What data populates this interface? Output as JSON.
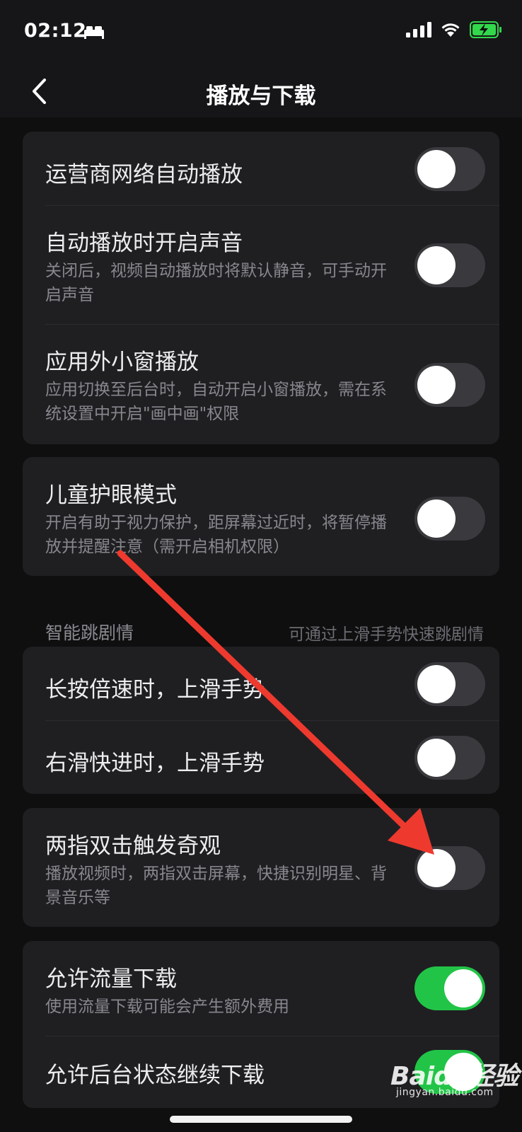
{
  "status_bar": {
    "time": "02:12",
    "icons": [
      "bed-icon",
      "signal-icon",
      "wifi-icon",
      "battery-charging-icon"
    ]
  },
  "nav": {
    "title": "播放与下载",
    "back_icon": "chevron-left-icon"
  },
  "cards": [
    {
      "rows": [
        {
          "title": "运营商网络自动播放",
          "desc": "",
          "toggle_on": false
        },
        {
          "title": "自动播放时开启声音",
          "desc": "关闭后，视频自动播放时将默认静音，可手动开启声音",
          "toggle_on": false
        },
        {
          "title": "应用外小窗播放",
          "desc": "应用切换至后台时，自动开启小窗播放，需在系统设置中开启\"画中画\"权限",
          "toggle_on": false
        }
      ]
    },
    {
      "rows": [
        {
          "title": "儿童护眼模式",
          "desc": "开启有助于视力保护，距屏幕过近时，将暂停播放并提醒注意（需开启相机权限）",
          "toggle_on": false
        }
      ]
    },
    {
      "rows": [
        {
          "title": "长按倍速时，上滑手势",
          "desc": "",
          "toggle_on": false
        },
        {
          "title": "右滑快进时，上滑手势",
          "desc": "",
          "toggle_on": false
        }
      ]
    },
    {
      "rows": [
        {
          "title": "两指双击触发奇观",
          "desc": "播放视频时，两指双击屏幕，快捷识别明星、背景音乐等",
          "toggle_on": false
        }
      ]
    },
    {
      "rows": [
        {
          "title": "允许流量下载",
          "desc": "使用流量下载可能会产生额外费用",
          "toggle_on": true
        },
        {
          "title": "允许后台状态继续下载",
          "desc": "",
          "toggle_on": true
        }
      ]
    }
  ],
  "section": {
    "label": "智能跳剧情",
    "hint": "可通过上滑手势快速跳剧情"
  },
  "watermark": {
    "logo": "Baidu经验",
    "sub": "jingyan.baidu.com"
  },
  "colors": {
    "toggle_on": "#22c447",
    "toggle_off": "#3a3a3e",
    "card_bg": "#1f1f22",
    "annotation_arrow": "#ee3a2e"
  }
}
